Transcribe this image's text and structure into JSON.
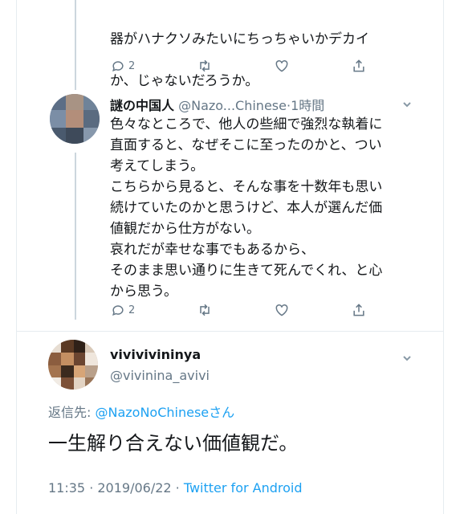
{
  "tweet1": {
    "text_lines": [
      "器がハナクソみたいにちっちゃいかデカイ",
      "か、じゃないだろうか。"
    ],
    "reply_count": "2"
  },
  "tweet2": {
    "name": "謎の中国人",
    "handle": "@Nazo...Chinese",
    "time": "1時間",
    "text": "色々なところで、他人の些細で強烈な執着に\n直面すると、なぜそこに至ったのかと、つい\n考えてしまう。\nこちらから見ると、そんな事を十数年も思い\n続けていたのかと思うけど、本人が選んだ価\n値観だから仕方がない。\n哀れだが幸せな事でもあるから、\nそのまま思い通りに生きて死んでくれ、と心\nから思う。",
    "reply_count": "2"
  },
  "focus": {
    "name": "vivivivininya",
    "handle": "@vivinina_avivi",
    "reply_prefix": "返信先: ",
    "reply_mention": "@NazoNoChineseさん",
    "text": "一生解り合えない価値観だ。",
    "timestamp": "11:35 · 2019/06/22 · ",
    "source": "Twitter for Android"
  },
  "colors": {
    "accent": "#1da1f2",
    "secondary_text": "#657786",
    "line": "#ccd6dd"
  },
  "icons": [
    "reply-icon",
    "retweet-icon",
    "like-icon",
    "share-icon",
    "chevron-down-icon"
  ]
}
